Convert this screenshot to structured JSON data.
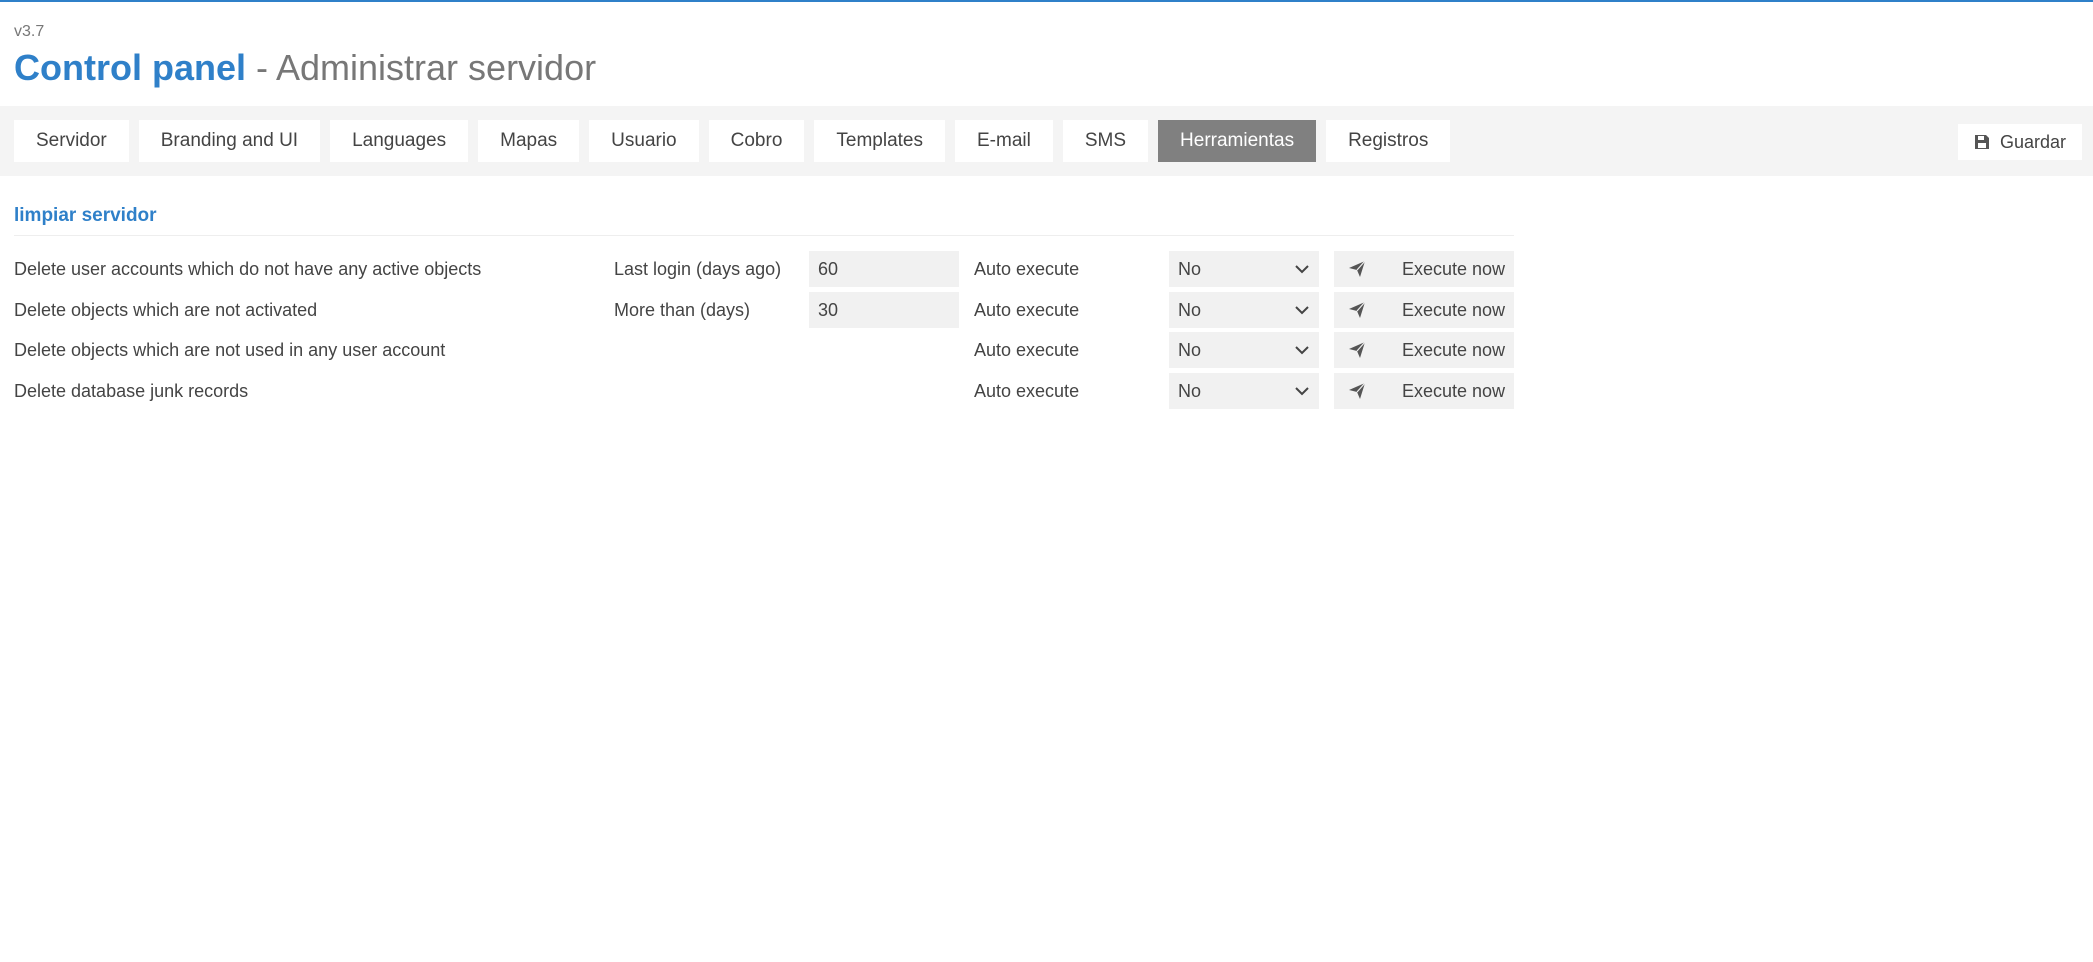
{
  "header": {
    "version": "v3.7",
    "title_brand": "Control panel",
    "title_sub": " - Administrar servidor"
  },
  "tabs": [
    {
      "label": "Servidor",
      "active": false
    },
    {
      "label": "Branding and UI",
      "active": false
    },
    {
      "label": "Languages",
      "active": false
    },
    {
      "label": "Mapas",
      "active": false
    },
    {
      "label": "Usuario",
      "active": false
    },
    {
      "label": "Cobro",
      "active": false
    },
    {
      "label": "Templates",
      "active": false
    },
    {
      "label": "E-mail",
      "active": false
    },
    {
      "label": "SMS",
      "active": false
    },
    {
      "label": "Herramientas",
      "active": true
    },
    {
      "label": "Registros",
      "active": false
    }
  ],
  "toolbar": {
    "save_label": "Guardar",
    "save_icon": "floppy-disk-icon"
  },
  "section": {
    "title": "limpiar servidor"
  },
  "rows": [
    {
      "description": "Delete user accounts which do not have any active objects",
      "param_label": "Last login (days ago)",
      "param_value": "60",
      "auto_label": "Auto execute",
      "auto_value": "No",
      "execute_label": "Execute now"
    },
    {
      "description": "Delete objects which are not activated",
      "param_label": "More than (days)",
      "param_value": "30",
      "auto_label": "Auto execute",
      "auto_value": "No",
      "execute_label": "Execute now"
    },
    {
      "description": "Delete objects which are not used in any user account",
      "auto_label": "Auto execute",
      "auto_value": "No",
      "execute_label": "Execute now"
    },
    {
      "description": "Delete database junk records",
      "auto_label": "Auto execute",
      "auto_value": "No",
      "execute_label": "Execute now"
    }
  ],
  "colors": {
    "accent": "#2f80c9",
    "active_tab": "#808080",
    "field_bg": "#f1f1f1",
    "toolbar_bg": "#f4f4f4"
  },
  "icons": {
    "execute": "paper-plane-icon",
    "select": "chevron-down-icon"
  }
}
